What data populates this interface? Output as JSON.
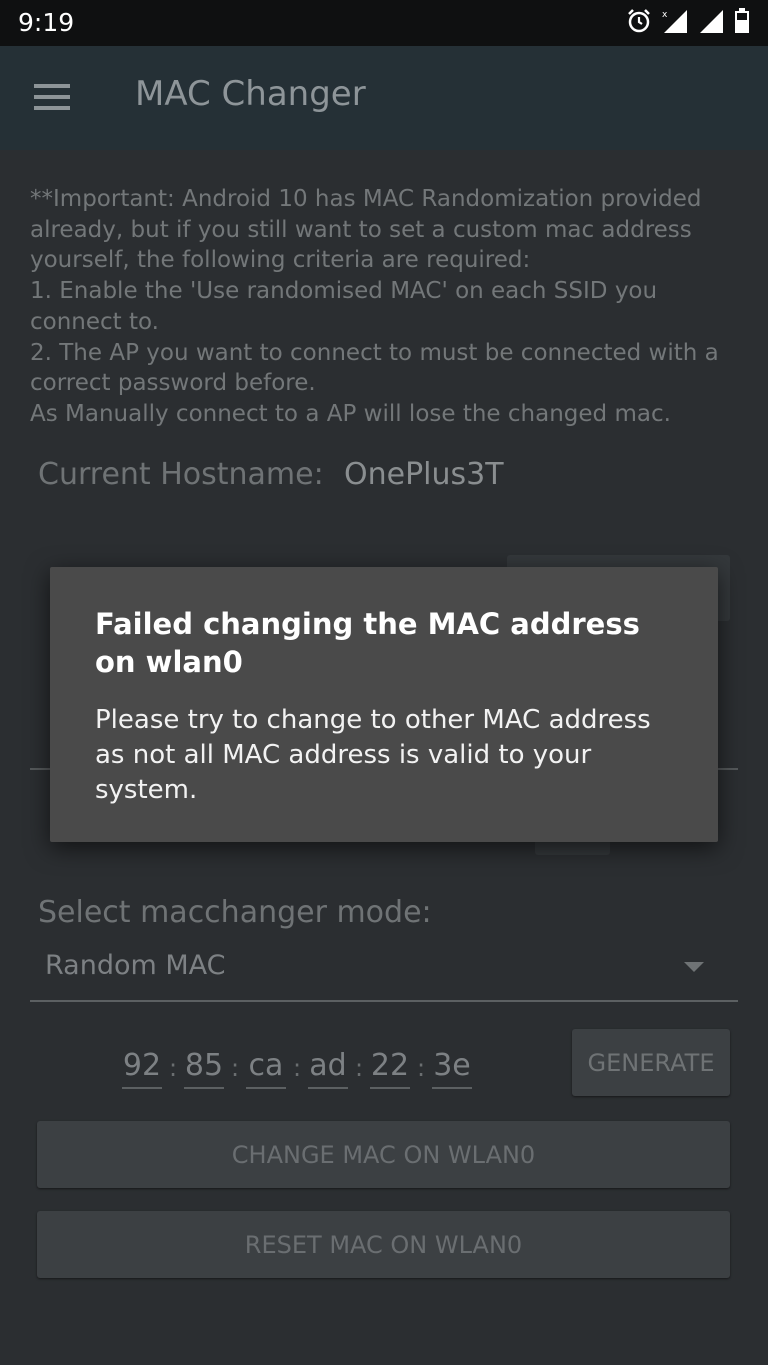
{
  "status_bar": {
    "time": "9:19",
    "icons": [
      "alarm-icon",
      "signal-icon",
      "signal-icon",
      "battery-icon"
    ]
  },
  "app_bar": {
    "title": "MAC Changer",
    "menu_icon": "menu-icon"
  },
  "notice": {
    "text": "**Important: Android 10 has MAC Randomization provided already, but if you still want to set a custom mac address yourself, the following criteria are required:\n1. Enable the 'Use randomised MAC' on each SSID you connect to.\n2. The AP you want to connect to must be connected with a correct password before.\nAs Manually connect to a AP will lose the changed mac."
  },
  "hostname": {
    "label": "Current Hostname:",
    "value": "OnePlus3T"
  },
  "mode": {
    "label": "Select macchanger mode:",
    "selected": "Random MAC"
  },
  "mac_octets": [
    "92",
    "85",
    "ca",
    "ad",
    "22",
    "3e"
  ],
  "buttons": {
    "generate": "GENERATE",
    "change": "CHANGE MAC ON WLAN0",
    "reset": "RESET MAC ON WLAN0"
  },
  "dialog": {
    "title": "Failed changing the MAC address on wlan0",
    "message": "Please try to change to other MAC address as not all MAC address is valid to your system."
  },
  "colors": {
    "status_bar": "#0f1011",
    "app_bar": "#253036",
    "background": "#2b2e31",
    "dialog": "#4a4a4a"
  }
}
